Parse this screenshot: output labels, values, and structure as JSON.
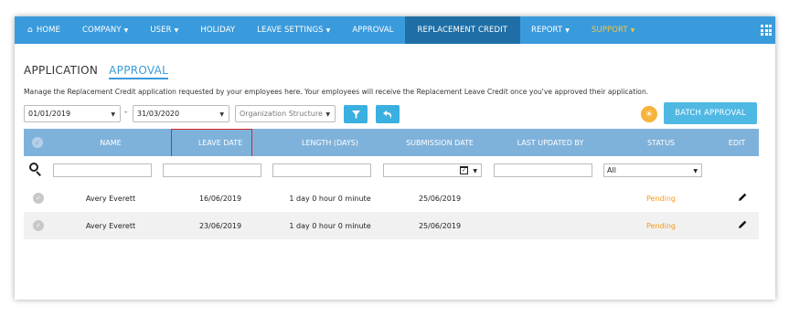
{
  "nav": {
    "home": "HOME",
    "items": [
      {
        "label": "COMPANY",
        "caret": true
      },
      {
        "label": "USER",
        "caret": true
      },
      {
        "label": "HOLIDAY",
        "caret": false
      },
      {
        "label": "LEAVE SETTINGS",
        "caret": true
      },
      {
        "label": "APPROVAL",
        "caret": false
      },
      {
        "label": "REPLACEMENT CREDIT",
        "caret": false,
        "active": true
      },
      {
        "label": "REPORT",
        "caret": true
      },
      {
        "label": "SUPPORT",
        "caret": true
      }
    ]
  },
  "tabs": {
    "application": "APPLICATION",
    "approval": "APPROVAL"
  },
  "description": "Manage the Replacement Credit application requested by your employees here. Your employees will receive the Replacement Leave Credit once you've approved their application.",
  "filters": {
    "date_from": "01/01/2019",
    "separator": "-",
    "date_to": "31/03/2020",
    "org_structure_placeholder": "Organization Structure",
    "batch_approval": "BATCH APPROVAL"
  },
  "table": {
    "columns": {
      "name": "NAME",
      "leave_date": "LEAVE DATE",
      "length": "LENGTH (DAYS)",
      "submission_date": "SUBMISSION DATE",
      "last_updated_by": "LAST UPDATED BY",
      "status": "STATUS",
      "edit": "EDIT"
    },
    "status_filter": "All",
    "rows": [
      {
        "name": "Avery Everett",
        "leave_date": "16/06/2019",
        "length": "1 day 0 hour 0 minute",
        "submission_date": "25/06/2019",
        "last_updated_by": "",
        "status": "Pending"
      },
      {
        "name": "Avery Everett",
        "leave_date": "23/06/2019",
        "length": "1 day 0 hour 0 minute",
        "submission_date": "25/06/2019",
        "last_updated_by": "",
        "status": "Pending"
      }
    ]
  },
  "colors": {
    "nav_bg": "#3a9bdc",
    "nav_active": "#1f6fa6",
    "support": "#f4c542",
    "table_header": "#7fb2db",
    "pending": "#f39a1e",
    "highlight_box": "#d9252a"
  }
}
